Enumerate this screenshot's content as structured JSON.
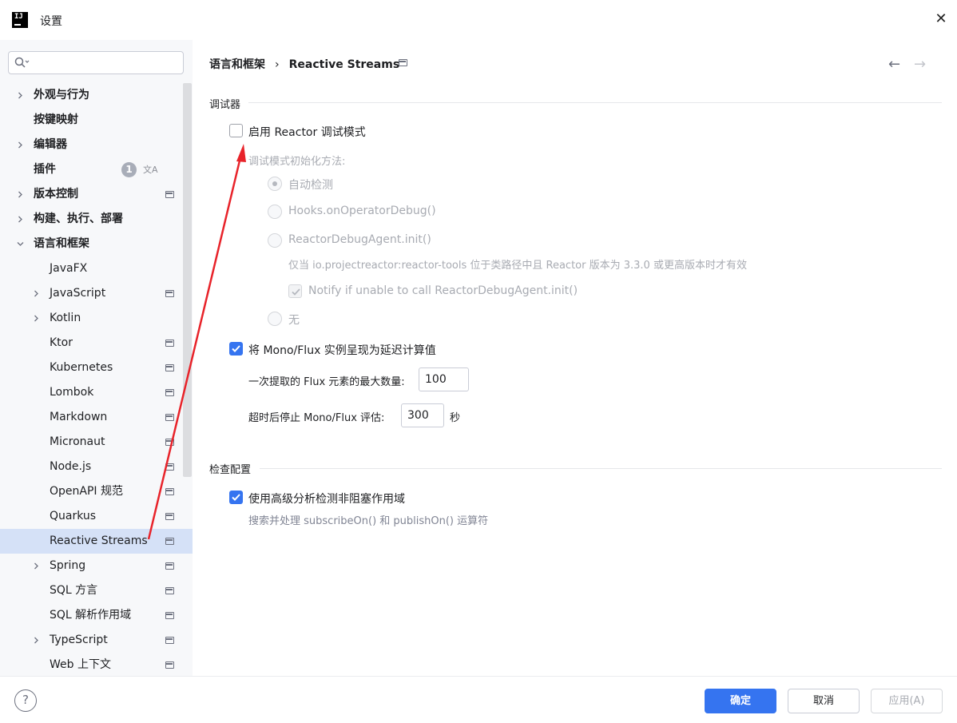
{
  "window": {
    "title": "设置",
    "logo_text": "IJ"
  },
  "search": {
    "placeholder": "",
    "value": ""
  },
  "sidebar": {
    "items": [
      {
        "label": "外观与行为",
        "bold": true,
        "level": 0,
        "expandable": true,
        "expanded": false,
        "page_icon": false
      },
      {
        "label": "按键映射",
        "bold": true,
        "level": 0,
        "expandable": false,
        "page_icon": false
      },
      {
        "label": "编辑器",
        "bold": true,
        "level": 0,
        "expandable": true,
        "expanded": false,
        "page_icon": false
      },
      {
        "label": "插件",
        "bold": true,
        "level": 0,
        "expandable": false,
        "page_icon": false,
        "badge": "1",
        "translate_icon": true
      },
      {
        "label": "版本控制",
        "bold": true,
        "level": 0,
        "expandable": true,
        "expanded": false,
        "page_icon": true
      },
      {
        "label": "构建、执行、部署",
        "bold": true,
        "level": 0,
        "expandable": true,
        "expanded": false,
        "page_icon": false
      },
      {
        "label": "语言和框架",
        "bold": true,
        "level": 0,
        "expandable": true,
        "expanded": true,
        "page_icon": false
      },
      {
        "label": "JavaFX",
        "level": 1,
        "expandable": false,
        "page_icon": false
      },
      {
        "label": "JavaScript",
        "level": 1,
        "expandable": true,
        "expanded": false,
        "page_icon": true
      },
      {
        "label": "Kotlin",
        "level": 1,
        "expandable": true,
        "expanded": false,
        "page_icon": false
      },
      {
        "label": "Ktor",
        "level": 1,
        "expandable": false,
        "page_icon": true
      },
      {
        "label": "Kubernetes",
        "level": 1,
        "expandable": false,
        "page_icon": true
      },
      {
        "label": "Lombok",
        "level": 1,
        "expandable": false,
        "page_icon": true
      },
      {
        "label": "Markdown",
        "level": 1,
        "expandable": false,
        "page_icon": true
      },
      {
        "label": "Micronaut",
        "level": 1,
        "expandable": false,
        "page_icon": true
      },
      {
        "label": "Node.js",
        "level": 1,
        "expandable": false,
        "page_icon": true
      },
      {
        "label": "OpenAPI 规范",
        "level": 1,
        "expandable": false,
        "page_icon": true
      },
      {
        "label": "Quarkus",
        "level": 1,
        "expandable": false,
        "page_icon": true
      },
      {
        "label": "Reactive Streams",
        "level": 1,
        "expandable": false,
        "page_icon": true,
        "selected": true
      },
      {
        "label": "Spring",
        "level": 1,
        "expandable": true,
        "expanded": false,
        "page_icon": true
      },
      {
        "label": "SQL 方言",
        "level": 1,
        "expandable": false,
        "page_icon": true
      },
      {
        "label": "SQL 解析作用域",
        "level": 1,
        "expandable": false,
        "page_icon": true
      },
      {
        "label": "TypeScript",
        "level": 1,
        "expandable": true,
        "expanded": false,
        "page_icon": true
      },
      {
        "label": "Web 上下文",
        "level": 1,
        "expandable": false,
        "page_icon": true
      }
    ]
  },
  "breadcrumb": {
    "parent": "语言和框架",
    "separator": "›",
    "current": "Reactive Streams"
  },
  "debugger": {
    "group_title": "调试器",
    "enable_label": "启用 Reactor 调试模式",
    "enable_checked": false,
    "init_method_label": "调试模式初始化方法:",
    "options": [
      {
        "label": "自动检测",
        "selected": true
      },
      {
        "label": "Hooks.onOperatorDebug()",
        "selected": false
      },
      {
        "label": "ReactorDebugAgent.init()",
        "selected": false
      }
    ],
    "agent_hint": "仅当 io.projectreactor:reactor-tools 位于类路径中且 Reactor 版本为 3.3.0 或更高版本时才有效",
    "notify_label": "Notify if unable to call ReactorDebugAgent.init()",
    "notify_checked": true,
    "none_label": "无",
    "lazy_label": "将 Mono/Flux 实例呈现为延迟计算值",
    "lazy_checked": true,
    "max_flux_label": "一次提取的 Flux 元素的最大数量:",
    "max_flux_value": "100",
    "timeout_label": "超时后停止 Mono/Flux 评估:",
    "timeout_value": "300",
    "timeout_unit": "秒"
  },
  "inspections": {
    "group_title": "检查配置",
    "advanced_label": "使用高级分析检测非阻塞作用域",
    "advanced_checked": true,
    "advanced_hint": "搜索并处理 subscribeOn() 和 publishOn() 运算符"
  },
  "footer": {
    "help": "?",
    "ok_label": "确定",
    "cancel_label": "取消",
    "apply_label": "应用(A)"
  },
  "colors": {
    "accent": "#3574f0",
    "selection": "#d5e1f7",
    "annotation_arrow": "#e8232a"
  }
}
